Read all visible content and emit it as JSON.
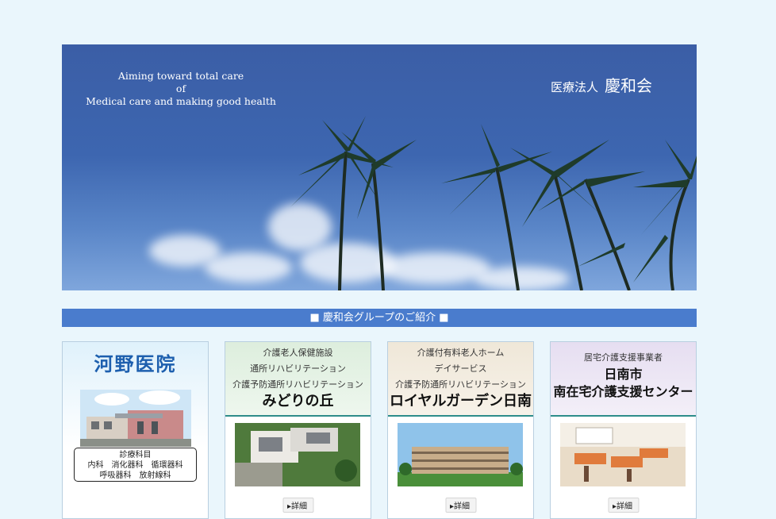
{
  "hero": {
    "tagline": [
      "Aiming toward total care",
      "of",
      "Medical care and making good health"
    ],
    "org_type": "医療法人",
    "org_name": "慶和会"
  },
  "section_title": "■ 慶和会グループのご紹介 ■",
  "cards": [
    {
      "title": "河野医院",
      "dept_title": "診療科目",
      "dept_lines": [
        "内科　消化器科　循環器科",
        "呼吸器科　放射線科"
      ]
    },
    {
      "lines": [
        "介護老人保健施設",
        "通所リハビリテーション",
        "介護予防通所リハビリテーション"
      ],
      "name": "みどりの丘",
      "more": "詳細"
    },
    {
      "lines": [
        "介護付有料老人ホーム",
        "デイサービス",
        "介護予防通所リハビリテーション"
      ],
      "name": "ロイヤルガーデン日南",
      "more": "詳細"
    },
    {
      "lines": [
        "居宅介護支援事業者"
      ],
      "name_lines": [
        "日南市",
        "南在宅介護支援センター"
      ],
      "more": "詳細"
    }
  ],
  "colors": {
    "page_bg": "#eaf6fc",
    "banner": "#4a7ccd",
    "accent_rule": "#2e8d8a",
    "clinic_title": "#1d5fae"
  }
}
